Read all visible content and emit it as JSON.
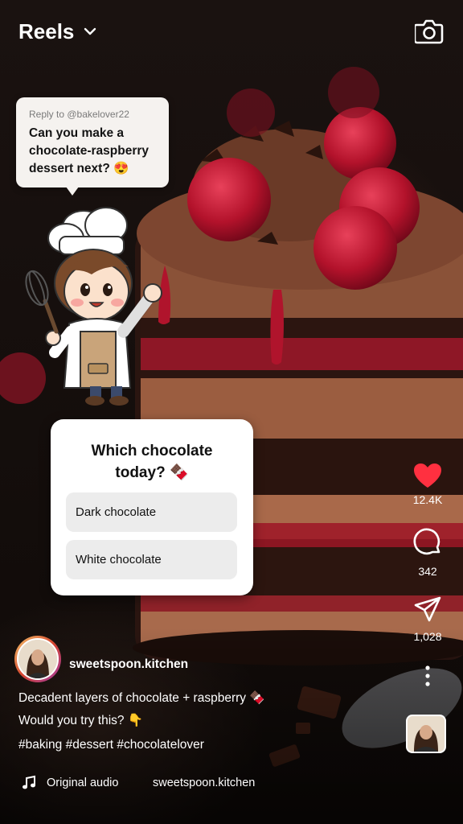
{
  "header": {
    "title": "Reels"
  },
  "reply": {
    "to": "Reply to @bakelover22",
    "text": "Can you make a chocolate-raspberry dessert next? 😍"
  },
  "poll": {
    "question": "Which chocolate today? 🍫",
    "options": [
      "Dark chocolate",
      "White chocolate"
    ]
  },
  "actions": {
    "likes": "12.4K",
    "comments": "342",
    "shares": "1,028",
    "like_color": "#ff3040"
  },
  "author": {
    "username": "sweetspoon.kitchen"
  },
  "caption": {
    "line1": "Decadent layers of chocolate + raspberry 🍫",
    "line2": "Would you try this? 👇",
    "hashtags": "#baking #dessert #chocolatelover"
  },
  "audio": {
    "label": "Original audio",
    "artist": "sweetspoon.kitchen"
  },
  "icons": [
    "chevron-down-icon",
    "camera-icon",
    "heart-icon",
    "comment-icon",
    "share-icon",
    "more-icon",
    "music-note-icon"
  ]
}
